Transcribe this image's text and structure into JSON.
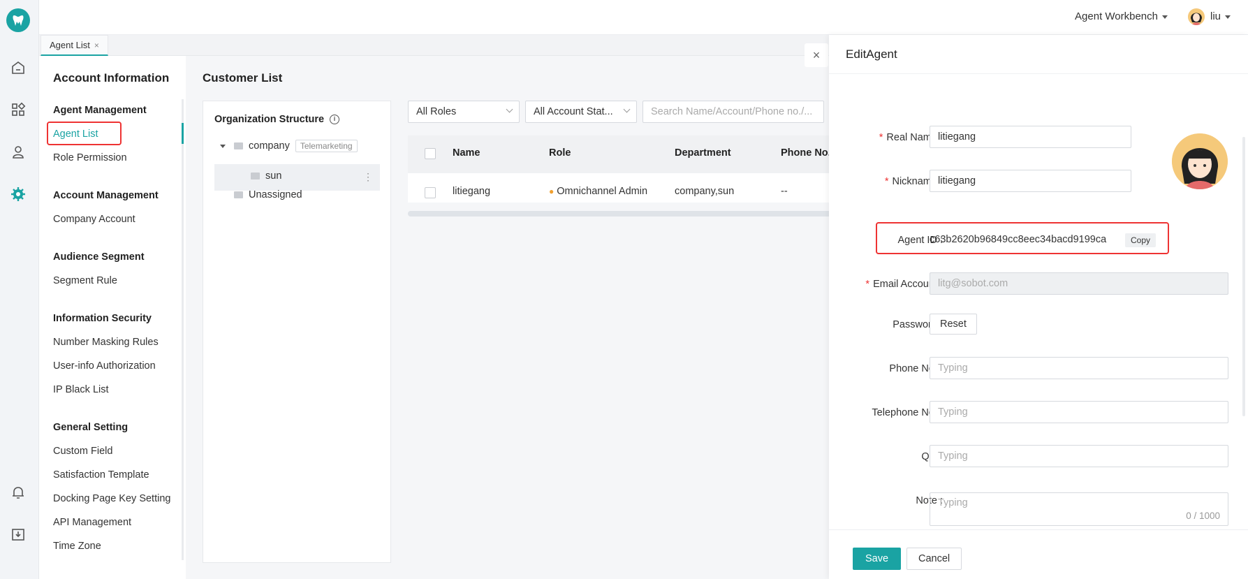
{
  "header": {
    "workbench_label": "Agent Workbench",
    "user_name": "liu"
  },
  "tabs": [
    {
      "label": "Agent List",
      "close": "×"
    }
  ],
  "sidebar": {
    "title": "Account Information",
    "groups": [
      {
        "title": "Agent Management",
        "items": [
          "Agent List",
          "Role Permission"
        ]
      },
      {
        "title": "Account Management",
        "items": [
          "Company Account"
        ]
      },
      {
        "title": "Audience Segment",
        "items": [
          "Segment Rule"
        ]
      },
      {
        "title": "Information Security",
        "items": [
          "Number Masking Rules",
          "User-info Authorization",
          "IP Black List"
        ]
      },
      {
        "title": "General Setting",
        "items": [
          "Custom Field",
          "Satisfaction Template",
          "Docking Page Key Setting",
          "API Management",
          "Time Zone"
        ]
      }
    ],
    "active_item": "Agent List"
  },
  "main": {
    "title": "Customer List",
    "org": {
      "title": "Organization Structure",
      "info_icon": "i",
      "nodes": {
        "company": "company",
        "company_tag": "Telemarketing",
        "sun": "sun",
        "unassigned": "Unassigned",
        "more": "⋮"
      }
    },
    "filters": {
      "roles": "All Roles",
      "status": "All Account Stat...",
      "search_placeholder": "Search Name/Account/Phone no./..."
    },
    "table": {
      "columns": [
        "Name",
        "Role",
        "Department",
        "Phone No."
      ],
      "rows": [
        {
          "name": "litiegang",
          "role": "Omnichannel Admin",
          "department": "company,sun",
          "phone": "--"
        }
      ]
    }
  },
  "drawer": {
    "close": "×",
    "title": "EditAgent",
    "fields": {
      "real_name_label": "Real Name :",
      "real_name_value": "litiegang",
      "nickname_label": "Nickname :",
      "nickname_value": "litiegang",
      "agent_id_label": "Agent ID :",
      "agent_id_value": "c63b2620b96849cc8eec34bacd9199ca",
      "copy_label": "Copy",
      "email_label": "Email Account :",
      "email_value": "litg@sobot.com",
      "password_label": "Password :",
      "reset_label": "Reset",
      "phone_label": "Phone No. :",
      "phone_placeholder": "Typing",
      "telephone_label": "Telephone No. :",
      "telephone_placeholder": "Typing",
      "qq_label": "QQ :",
      "qq_placeholder": "Typing",
      "note_label": "Note :",
      "note_placeholder": "Typing",
      "note_count": "0 / 1000"
    },
    "required_mark": "*",
    "save_label": "Save",
    "cancel_label": "Cancel"
  },
  "colors": {
    "accent": "#1aa3a3",
    "highlight": "#e33333"
  }
}
